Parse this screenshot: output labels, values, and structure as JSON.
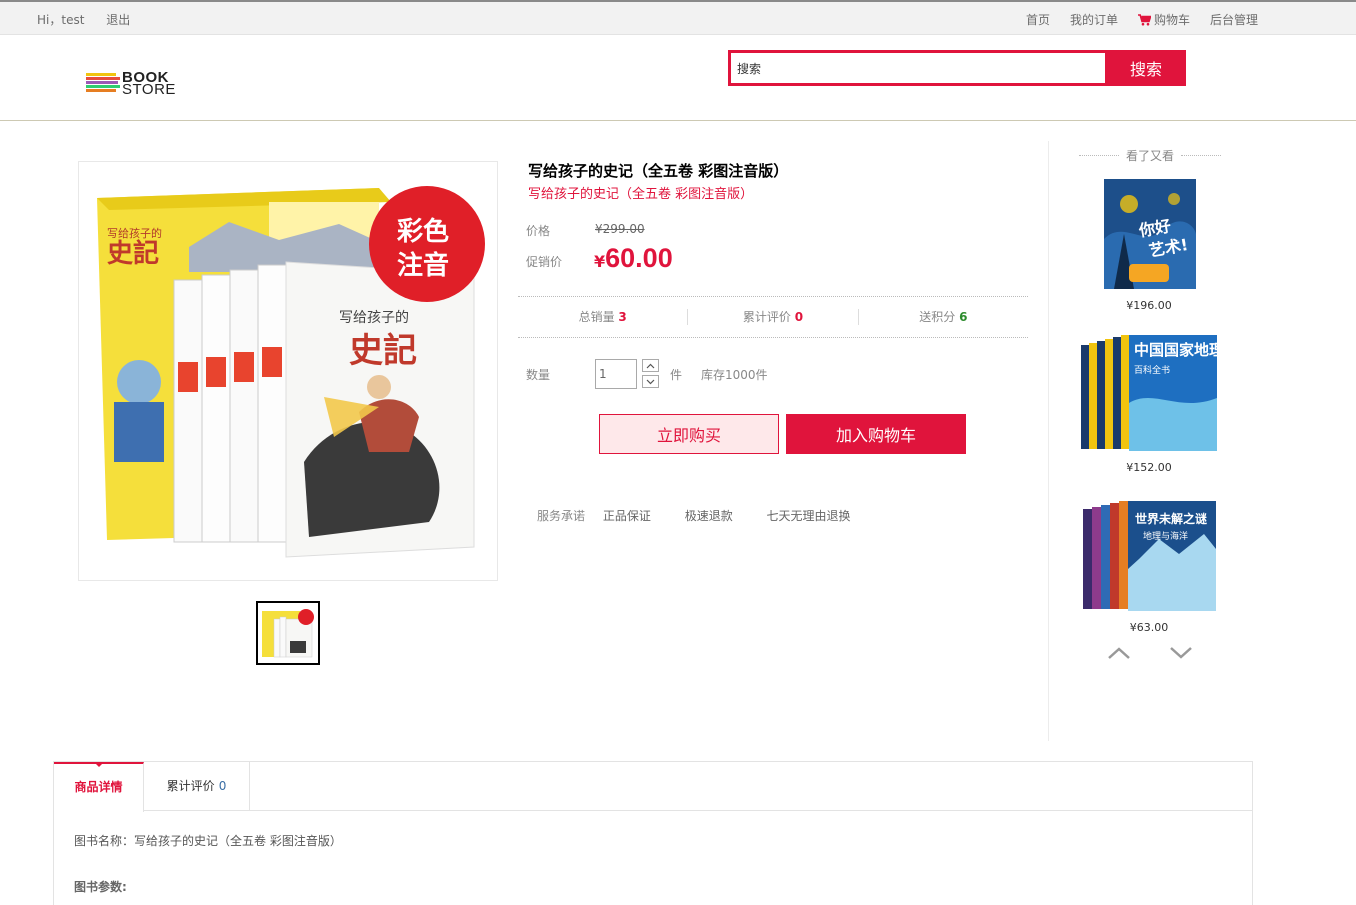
{
  "topbar": {
    "greeting": "Hi，test",
    "logout": "退出",
    "nav": [
      "首页",
      "我的订单",
      "购物车",
      "后台管理"
    ]
  },
  "header": {
    "logo_line1": "BOOK",
    "logo_line2": "STORE",
    "search_placeholder": "搜索",
    "search_value": "搜索",
    "search_button": "搜索"
  },
  "colors": {
    "accent": "#e0143c",
    "accent_light": "#fee8ea",
    "green": "#2d8b2d"
  },
  "product": {
    "title": "写给孩子的史记（全五卷 彩图注音版）",
    "subtitle": "写给孩子的史记（全五卷 彩图注音版）",
    "price_label": "价格",
    "price_original": "¥299.00",
    "promo_label": "促销价",
    "promo_currency": "¥",
    "promo_price": "60.00",
    "stats": {
      "sales_label": "总销量",
      "sales_value": "3",
      "reviews_label": "累计评价",
      "reviews_value": "0",
      "points_label": "送积分",
      "points_value": "6"
    },
    "qty_label": "数量",
    "qty_value": "1",
    "qty_unit": "件",
    "stock": "库存1000件",
    "buy_now": "立即购买",
    "add_cart": "加入购物车",
    "service_label": "服务承诺",
    "services": [
      "正品保证",
      "极速退款",
      "七天无理由退换"
    ],
    "cover_badge_line1": "彩色",
    "cover_badge_line2": "注音",
    "cover_title": "写给孩子的",
    "cover_big": "史記"
  },
  "sidebar": {
    "title": "看了又看",
    "items": [
      {
        "price": "¥196.00",
        "cover_text": "你好艺术!"
      },
      {
        "price": "¥152.00",
        "cover_text": "中国国家地理",
        "cover_sub": "百科全书"
      },
      {
        "price": "¥63.00",
        "cover_text": "世界未解之谜",
        "cover_sub": "地理与海洋"
      }
    ]
  },
  "tabs": {
    "detail": "商品详情",
    "reviews": "累计评价",
    "reviews_count": "0"
  },
  "details": {
    "name_line": "图书名称：写给孩子的史记（全五卷 彩图注音版）",
    "params_label": "图书参数:"
  }
}
